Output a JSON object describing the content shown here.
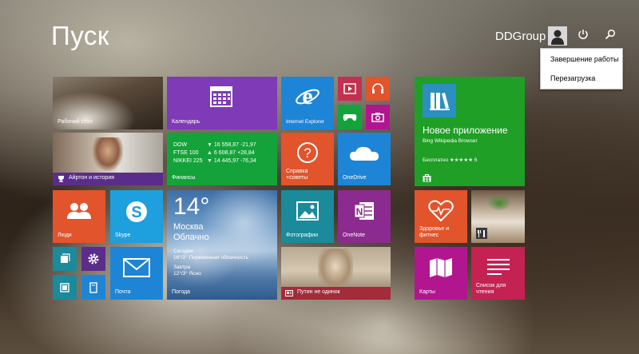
{
  "header": {
    "title": "Пуск",
    "user_name": "DDGroup"
  },
  "power_menu": {
    "items": [
      "Завершение работы",
      "Перезагрузка"
    ]
  },
  "tiles": {
    "desktop": "Рабочий стол",
    "calendar": "Календарь",
    "ie": "Internet Explorer",
    "senna": "Айртон и история",
    "finance": {
      "label": "Финансы",
      "rows": [
        {
          "name": "DOW",
          "value": "▼ 16 558,87 -21,97"
        },
        {
          "name": "FTSE 100",
          "value": "▲ 6 608,87 +28,84"
        },
        {
          "name": "NIKKEI 225",
          "value": "▼ 14 445,97 -76,34"
        }
      ]
    },
    "help": "Справка\n+советы",
    "onedrive": "OneDrive",
    "people": "Люди",
    "skype": "Skype",
    "weather": {
      "temp": "14°",
      "city": "Москва",
      "condition": "Облачно",
      "today_label": "Сегодня",
      "today_text": "16°/2° Переменная облачность",
      "tomorrow_label": "Завтра",
      "tomorrow_text": "12°/3° Ясно",
      "label": "Погода"
    },
    "photos": "Фотографии",
    "onenote": "OneNote",
    "mail": "Почта",
    "news": "Путин не одинок",
    "store": {
      "title": "Новое приложение",
      "subtitle": "Bing Wikipedia Browser",
      "rating": "Бесплатно ★★★★★ 6"
    },
    "health": "Здоровье и\nфитнес",
    "maps": "Карты",
    "reading_list": "Список для\nчтения"
  },
  "colors": {
    "purple": "#7e3ab7",
    "blue": "#1e85d6",
    "green": "#14a33a",
    "orange": "#e1542c",
    "red": "#c4304f",
    "teal": "#1b8a9a",
    "magenta": "#b1168f",
    "store_green": "#1f9f26",
    "crimson": "#c42253"
  }
}
